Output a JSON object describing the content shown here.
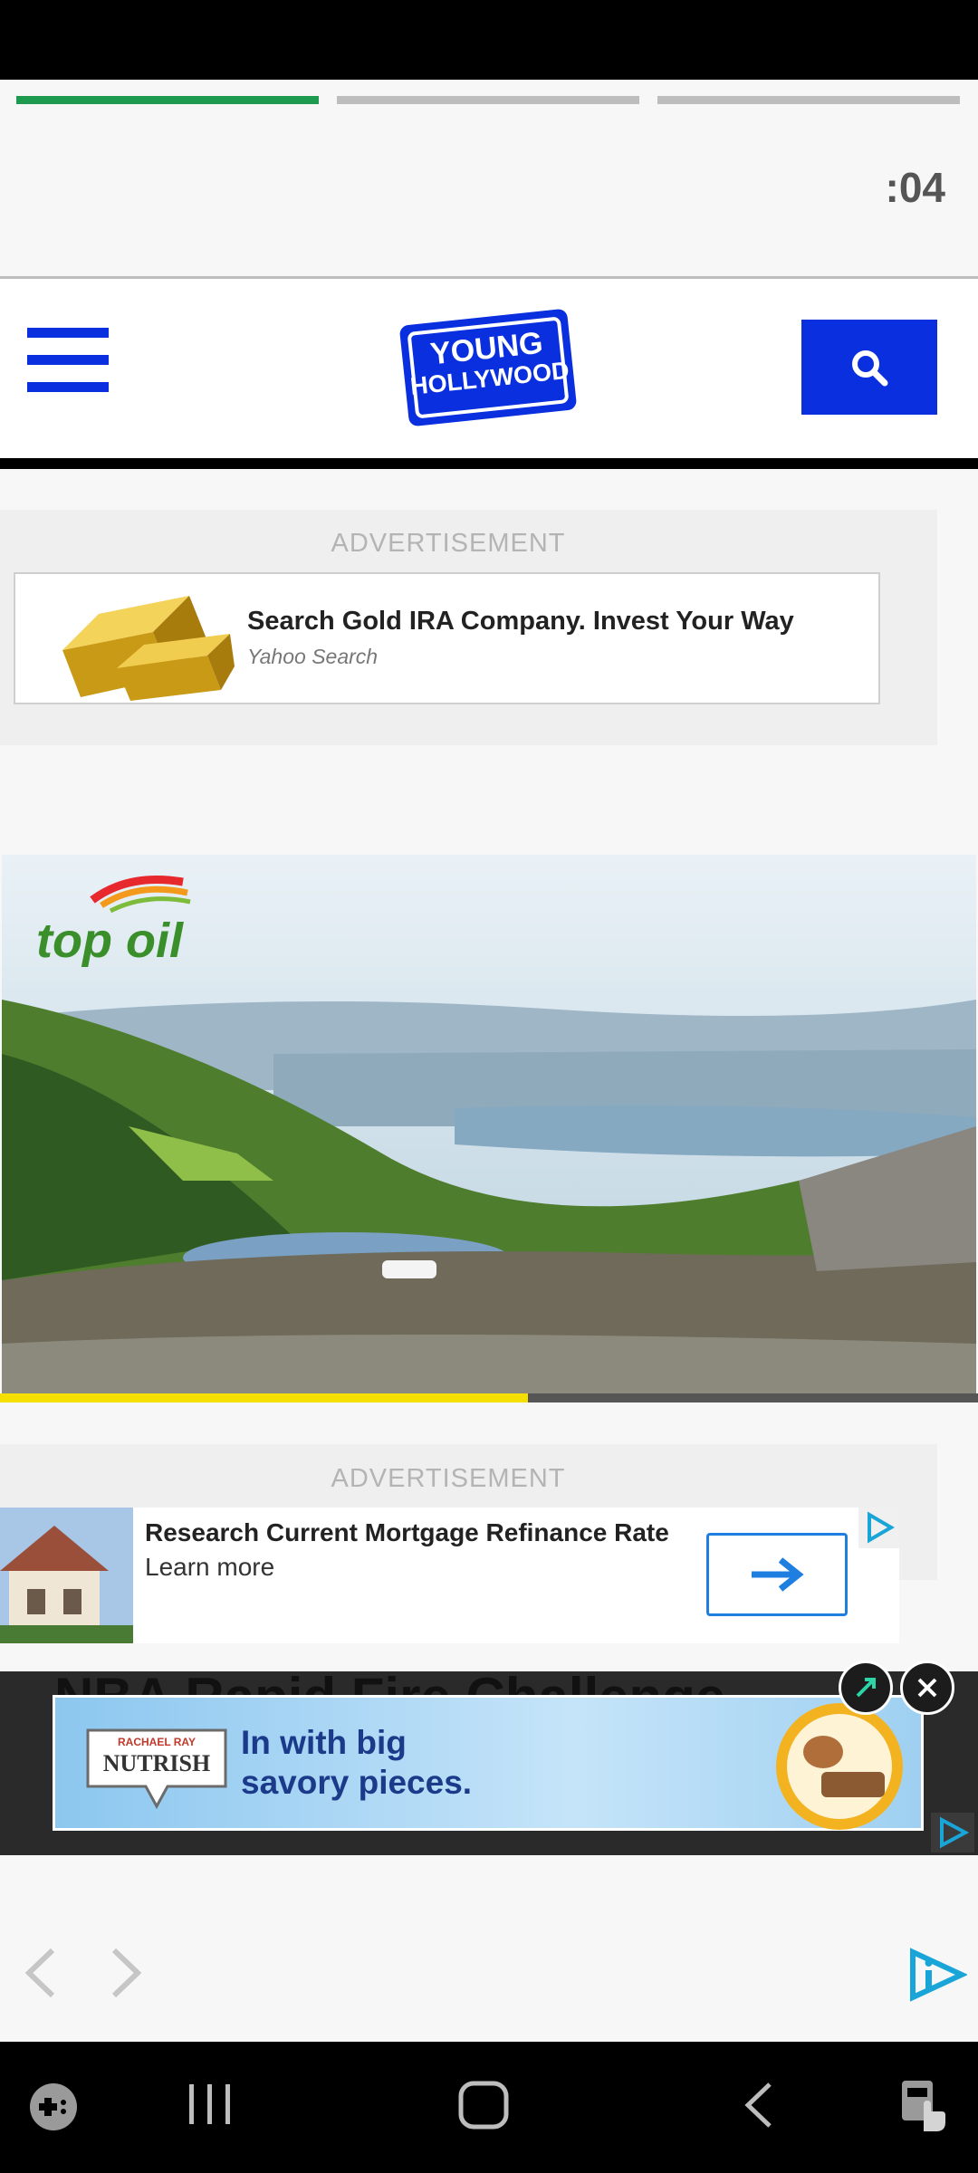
{
  "story": {
    "progress": [
      1,
      0,
      0
    ],
    "timer": ":04"
  },
  "header": {
    "logo_line1": "YOUNG",
    "logo_line2": "HOLLYWOOD",
    "brand_color": "#0a2fde"
  },
  "ad1": {
    "label": "ADVERTISEMENT",
    "title": "Search Gold IRA Company. Invest Your Way",
    "source": "Yahoo Search"
  },
  "video": {
    "brand": "top oil",
    "progress_fraction": 0.54,
    "accent": "#f4df00"
  },
  "ad2": {
    "label": "ADVERTISEMENT",
    "title": "Research Current Mortgage Refinance Rate",
    "cta_text": "Learn more"
  },
  "sticky_ad": {
    "brand_top": "RACHAEL RAY",
    "brand": "NUTRISH",
    "text_line1": "In with big",
    "text_line2": "savory pieces.",
    "headline_behind": "NBA Rapid Fire Challenge"
  },
  "icons": {
    "status": "status-bar",
    "menu": "hamburger-icon",
    "search": "search-icon",
    "back": "chevron-left-icon",
    "forward": "chevron-right-icon",
    "adchoices": "adchoices-icon"
  }
}
